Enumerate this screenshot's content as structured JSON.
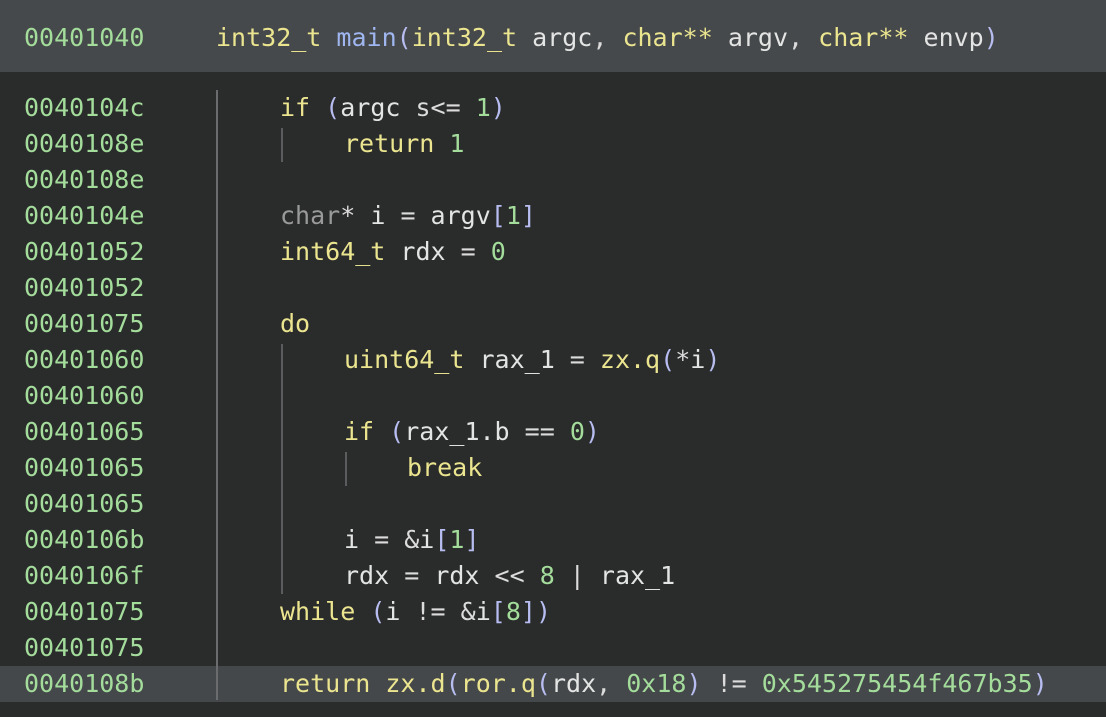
{
  "header": {
    "address": "00401040",
    "return_type": "int32_t",
    "func_name": "main",
    "params": [
      {
        "type": "int32_t",
        "name": "argc"
      },
      {
        "type": "char**",
        "name": "argv"
      },
      {
        "type": "char**",
        "name": "envp"
      }
    ]
  },
  "lines": [
    {
      "address": "0040104c",
      "tokens": [
        [
          "kw",
          "if"
        ],
        [
          "op",
          " "
        ],
        [
          "pun",
          "("
        ],
        [
          "id",
          "argc"
        ],
        [
          "op",
          " s<= "
        ],
        [
          "num",
          "1"
        ],
        [
          "pun",
          ")"
        ]
      ]
    },
    {
      "address": "0040108e",
      "tokens": [
        [
          "kw",
          "return"
        ],
        [
          "op",
          " "
        ],
        [
          "num",
          "1"
        ]
      ]
    },
    {
      "address": "0040108e",
      "tokens": []
    },
    {
      "address": "0040104e",
      "tokens": [
        [
          "dim",
          "char"
        ],
        [
          "op",
          "* "
        ],
        [
          "id",
          "i"
        ],
        [
          "op",
          " = "
        ],
        [
          "id",
          "argv"
        ],
        [
          "pun",
          "["
        ],
        [
          "num",
          "1"
        ],
        [
          "pun",
          "]"
        ]
      ]
    },
    {
      "address": "00401052",
      "tokens": [
        [
          "ty",
          "int64_t"
        ],
        [
          "op",
          " "
        ],
        [
          "id",
          "rdx"
        ],
        [
          "op",
          " = "
        ],
        [
          "num",
          "0"
        ]
      ]
    },
    {
      "address": "00401052",
      "tokens": []
    },
    {
      "address": "00401075",
      "tokens": [
        [
          "kw",
          "do"
        ]
      ]
    },
    {
      "address": "00401060",
      "tokens": [
        [
          "ty",
          "uint64_t"
        ],
        [
          "op",
          " "
        ],
        [
          "id",
          "rax_1"
        ],
        [
          "op",
          " = "
        ],
        [
          "fn",
          "zx.q"
        ],
        [
          "pun",
          "("
        ],
        [
          "op",
          "*"
        ],
        [
          "id",
          "i"
        ],
        [
          "pun",
          ")"
        ]
      ]
    },
    {
      "address": "00401060",
      "tokens": []
    },
    {
      "address": "00401065",
      "tokens": [
        [
          "kw",
          "if"
        ],
        [
          "op",
          " "
        ],
        [
          "pun",
          "("
        ],
        [
          "id",
          "rax_1.b"
        ],
        [
          "op",
          " == "
        ],
        [
          "num",
          "0"
        ],
        [
          "pun",
          ")"
        ]
      ]
    },
    {
      "address": "00401065",
      "tokens": [
        [
          "kw",
          "break"
        ]
      ]
    },
    {
      "address": "00401065",
      "tokens": []
    },
    {
      "address": "0040106b",
      "tokens": [
        [
          "id",
          "i"
        ],
        [
          "op",
          " = &"
        ],
        [
          "id",
          "i"
        ],
        [
          "pun",
          "["
        ],
        [
          "num",
          "1"
        ],
        [
          "pun",
          "]"
        ]
      ]
    },
    {
      "address": "0040106f",
      "tokens": [
        [
          "id",
          "rdx"
        ],
        [
          "op",
          " = "
        ],
        [
          "id",
          "rdx"
        ],
        [
          "op",
          " << "
        ],
        [
          "num",
          "8"
        ],
        [
          "op",
          " | "
        ],
        [
          "id",
          "rax_1"
        ]
      ]
    },
    {
      "address": "00401075",
      "tokens": [
        [
          "kw",
          "while"
        ],
        [
          "op",
          " "
        ],
        [
          "pun",
          "("
        ],
        [
          "id",
          "i"
        ],
        [
          "op",
          " != &"
        ],
        [
          "id",
          "i"
        ],
        [
          "pun",
          "["
        ],
        [
          "num",
          "8"
        ],
        [
          "pun",
          "])"
        ]
      ]
    },
    {
      "address": "00401075",
      "tokens": []
    },
    {
      "address": "0040108b",
      "highlighted": true,
      "tokens": [
        [
          "kw",
          "return"
        ],
        [
          "op",
          " "
        ],
        [
          "fn",
          "zx.d"
        ],
        [
          "pun",
          "("
        ],
        [
          "fn",
          "ror.q"
        ],
        [
          "pun",
          "("
        ],
        [
          "id",
          "rdx"
        ],
        [
          "op",
          ", "
        ],
        [
          "num",
          "0x18"
        ],
        [
          "pun",
          ")"
        ],
        [
          "op",
          " != "
        ],
        [
          "num",
          "0x545275454f467b35"
        ],
        [
          "pun",
          ")"
        ]
      ]
    }
  ]
}
